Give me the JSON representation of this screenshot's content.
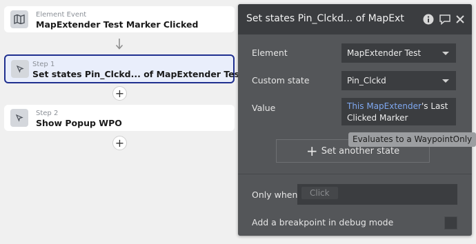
{
  "workflow": {
    "event": {
      "subtitle": "Element Event",
      "title": "MapExtender Test Marker Clicked",
      "icon": "map-icon"
    },
    "step1": {
      "subtitle": "Step 1",
      "title": "Set states Pin_Clckd... of MapExtender Test",
      "icon": "cursor-arrow-icon"
    },
    "step2": {
      "subtitle": "Step 2",
      "title": "Show Popup WPO",
      "icon": "cursor-arrow-icon"
    },
    "add_step_symbol": "+"
  },
  "panel": {
    "title": "Set states Pin_Clckd... of MapExt",
    "icons": [
      "info-icon",
      "comment-icon",
      "close-icon"
    ],
    "element": {
      "label": "Element",
      "value": "MapExtender Test"
    },
    "custom_state": {
      "label": "Custom state",
      "value": "Pin_Clckd"
    },
    "value": {
      "label": "Value",
      "dynamic": "This MapExtender",
      "rest": "'s Last Clicked Marker"
    },
    "tooltip": "Evaluates to a WaypointOnly",
    "set_another_state": {
      "icon": "+",
      "label": "Set another state"
    },
    "only_when": {
      "label": "Only when",
      "placeholder": "Click"
    },
    "breakpoint": {
      "label": "Add a breakpoint in debug mode"
    }
  },
  "colors": {
    "selected_border": "#1f2f8f",
    "selected_bg": "#e9eefb",
    "panel_bg": "#545659",
    "header_bg": "#3b3d40",
    "dynamic_text": "#7fa8f0"
  }
}
